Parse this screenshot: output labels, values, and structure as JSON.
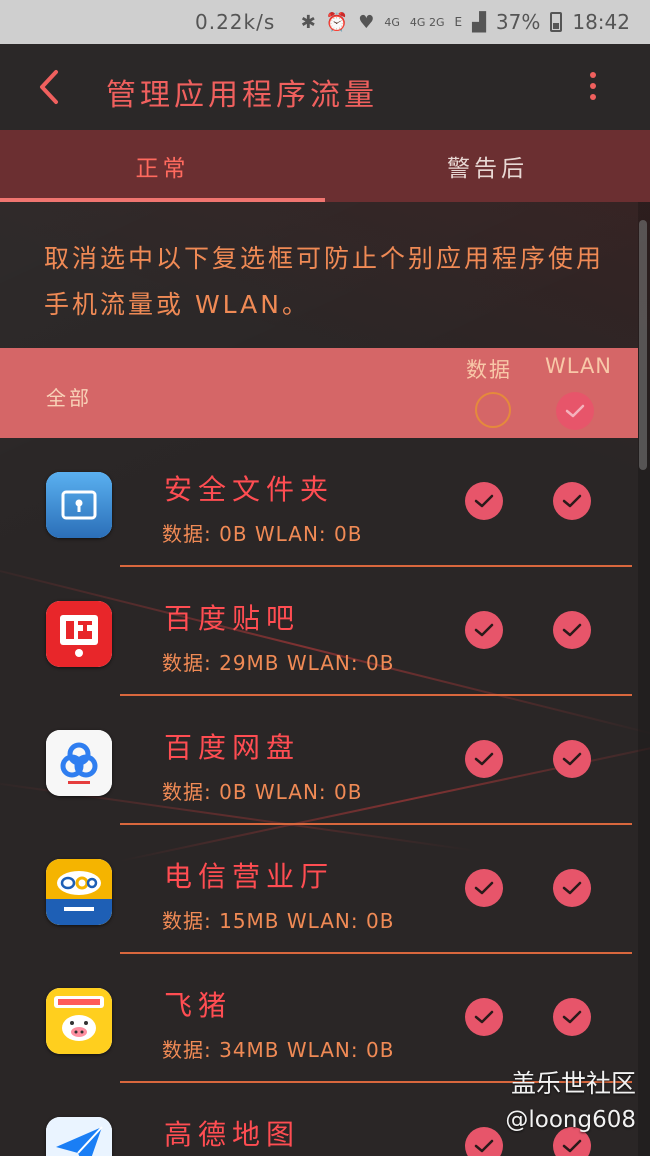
{
  "status_bar": {
    "net_speed": "0.22k/s",
    "signal_1": "4G",
    "signal_2": "4G 2G",
    "signal_e": "E",
    "battery": "37%",
    "time": "18:42"
  },
  "app_bar": {
    "title": "管理应用程序流量"
  },
  "tabs": [
    {
      "label": "正常",
      "selected": true
    },
    {
      "label": "警告后",
      "selected": false
    }
  ],
  "note": "取消选中以下复选框可防止个别应用程序使用手机流量或 WLAN。",
  "header": {
    "all_label": "全部",
    "data_col": "数据",
    "wlan_col": "WLAN"
  },
  "apps": [
    {
      "name": "安全文件夹",
      "usage": "数据: 0B WLAN: 0B",
      "icon": "secure-folder-icon",
      "data": true,
      "wlan": true
    },
    {
      "name": "百度贴吧",
      "usage": "数据: 29MB WLAN: 0B",
      "icon": "baidu-tieba-icon",
      "data": true,
      "wlan": true
    },
    {
      "name": "百度网盘",
      "usage": "数据: 0B WLAN: 0B",
      "icon": "baidu-netdisk-icon",
      "data": true,
      "wlan": true
    },
    {
      "name": "电信营业厅",
      "usage": "数据: 15MB WLAN: 0B",
      "icon": "telecom-icon",
      "data": true,
      "wlan": true
    },
    {
      "name": "飞猪",
      "usage": "数据: 34MB WLAN: 0B",
      "icon": "fliggy-icon",
      "data": true,
      "wlan": true
    },
    {
      "name": "高德地图",
      "usage": "",
      "icon": "amap-icon",
      "data": true,
      "wlan": true
    }
  ],
  "watermark": {
    "line1": "盖乐世社区",
    "line2": "@loong608"
  },
  "colors": {
    "accent": "#f0605e",
    "checkbox": "#e7556a",
    "band": "#d56667",
    "tab_bg": "#6b2f31",
    "usage_text": "#f08a55"
  }
}
